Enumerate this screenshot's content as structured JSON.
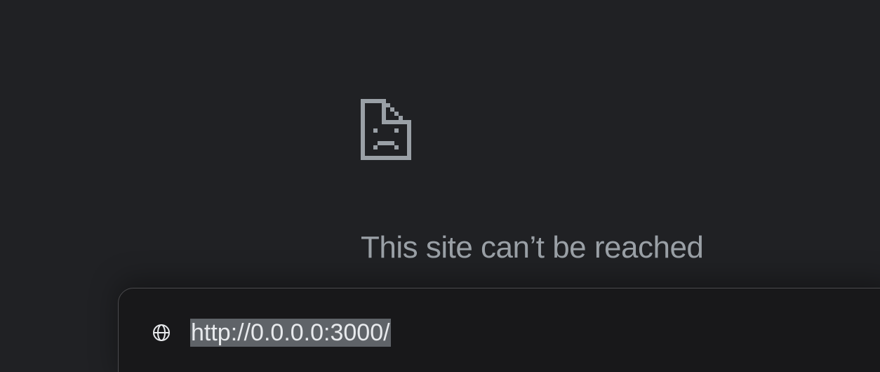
{
  "error": {
    "icon": "sad-document-icon",
    "title": "This site can’t be reached"
  },
  "omnibox": {
    "icon": "globe-icon",
    "url": "http://0.0.0.0:3000/"
  },
  "colors": {
    "background": "#202124",
    "title": "#9aa0a6",
    "omnibox_bg": "#18181a",
    "selection": "#5f6368"
  }
}
